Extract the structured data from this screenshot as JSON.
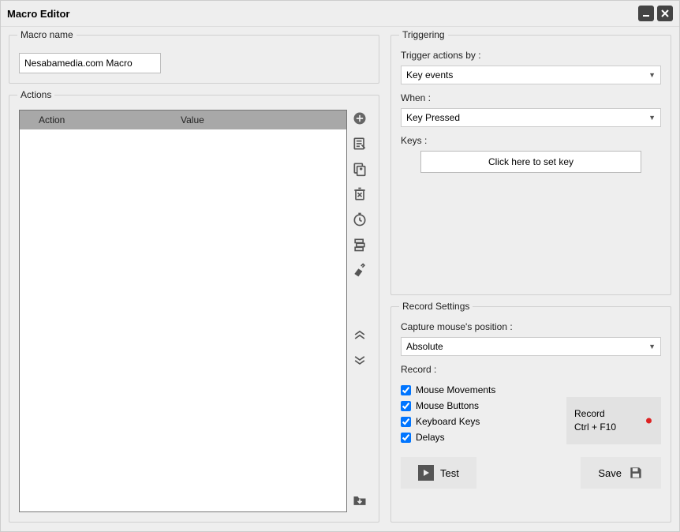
{
  "window": {
    "title": "Macro Editor"
  },
  "macroName": {
    "groupTitle": "Macro name",
    "value": "Nesabamedia.com Macro"
  },
  "actions": {
    "groupTitle": "Actions",
    "col_action": "Action",
    "col_value": "Value"
  },
  "triggering": {
    "groupTitle": "Triggering",
    "label_trigger": "Trigger actions by :",
    "trigger_value": "Key events",
    "label_when": "When :",
    "when_value": "Key Pressed",
    "label_keys": "Keys :",
    "setkey": "Click here to set key"
  },
  "recordSettings": {
    "groupTitle": "Record Settings",
    "label_capture": "Capture mouse's position :",
    "capture_value": "Absolute",
    "label_record": "Record :",
    "chk_mouse_move": "Mouse Movements",
    "chk_mouse_btn": "Mouse Buttons",
    "chk_keyboard": "Keyboard Keys",
    "chk_delays": "Delays",
    "rec_label": "Record",
    "rec_hotkey": "Ctrl + F10"
  },
  "buttons": {
    "test": "Test",
    "save": "Save"
  }
}
